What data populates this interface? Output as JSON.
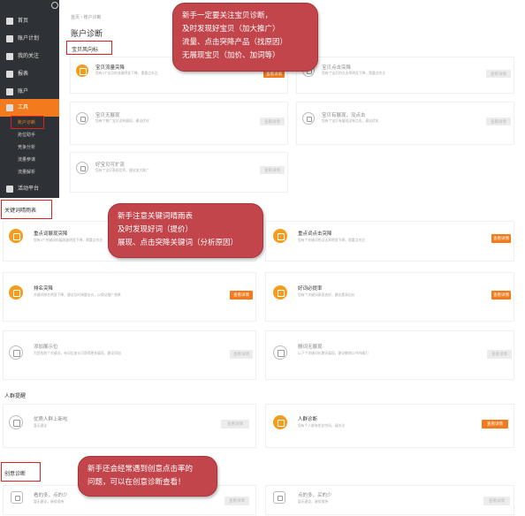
{
  "sidebar": {
    "items": [
      {
        "label": "首页"
      },
      {
        "label": "账户计划"
      },
      {
        "label": "我的关注"
      },
      {
        "label": "报表"
      },
      {
        "label": "账户"
      },
      {
        "label": "工具"
      }
    ],
    "sub_items": [
      {
        "label": "账户诊断"
      },
      {
        "label": "抢位助手"
      },
      {
        "label": "竞争分析"
      },
      {
        "label": "流量参谋"
      },
      {
        "label": "流量解析"
      }
    ],
    "bottom_item": {
      "label": "活动平台"
    }
  },
  "breadcrumb": "首页  ›  账户诊断",
  "page_title": "账户诊断",
  "sections": {
    "baobei": "宝贝风向标",
    "keyword": "关键词晴雨表",
    "crowd": "人群提醒",
    "creative": "创意诊断"
  },
  "cards": {
    "baobei_1": {
      "title": "宝贝流量突降",
      "desc": "您有3个宝贝的流量明显下降，需重点关注",
      "button": "查看详情"
    },
    "baobei_2": {
      "title": "宝贝点击突降",
      "desc": "您有个宝贝的点击率明显下降，需重点关注",
      "button": "查看详情"
    },
    "baobei_3": {
      "title": "宝贝无展现",
      "desc": "您有个推广宝贝没有展现，建议优化",
      "button": "查看详情"
    },
    "baobei_4": {
      "title": "宝贝有展现，没点击",
      "desc": "您有个宝贝有展现没有点击，建议优化",
      "button": "查看详情"
    },
    "baobei_5": {
      "title": "好宝贝可扩流",
      "desc": "您有个宝贝表现优秀，建议加大推广",
      "button": "查看详情"
    },
    "kw_1": {
      "title": "重点词展现突降",
      "desc": "您有3个关键词的展现量明显下降，需重点关注",
      "button": "查看详情"
    },
    "kw_2": {
      "title": "重点词点击突降",
      "desc": "您有个关键词的点击率明显下降，需重点关注",
      "button": "查看详情"
    },
    "kw_3": {
      "title": "排名突降",
      "desc": "关键词排名明显下降，建议及时调整出价，以保证推广效果",
      "button": "查看详情"
    },
    "kw_4": {
      "title": "好词必提率",
      "desc": "您有个关键词表现良好，建议提高出价",
      "button": "查看详情"
    },
    "kw_5": {
      "title": "添加展示位",
      "desc": "为您找到个关键词，有词后加价可获得更多展现，建议添加",
      "button": "查看详情"
    },
    "kw_6": {
      "title": "删词无展现",
      "desc": "以下个关键词长期无展现，建议删除以节约精力",
      "button": "查看详情"
    },
    "crowd_1": {
      "title": "优质人群上新啦",
      "desc": "暂无建议",
      "button": "查看详情"
    },
    "crowd_2": {
      "title": "人群诊断",
      "desc": "您有个人群有优化空间，请关注",
      "button": "查看详情"
    },
    "creative_1": {
      "title": "看的多，点的少",
      "desc": "暂无建议，继续保持",
      "button": "查看详情"
    },
    "creative_2": {
      "title": "点的多，买的少",
      "desc": "暂无建议，继续保持",
      "button": "查看详情"
    }
  },
  "callouts": {
    "baobei": [
      "新手一定要关注宝贝诊断，",
      "及时发现好宝贝（加大推广）",
      "流量、点击突降产品（找原因）",
      "无展现宝贝（加价、加词等）"
    ],
    "keyword": [
      "新手注意关键词晴雨表",
      "及时发现好词（提价）",
      "展现、点击突降关键词（分析原因）"
    ],
    "creative": [
      "新手还会经常遇到创意点击率的",
      "问题，可以在创意诊断查看！"
    ]
  },
  "colors": {
    "accent": "#f37b1d",
    "callout": "#c2454b",
    "highlight_box": "#e02020",
    "sidebar_bg": "#2e3135"
  }
}
